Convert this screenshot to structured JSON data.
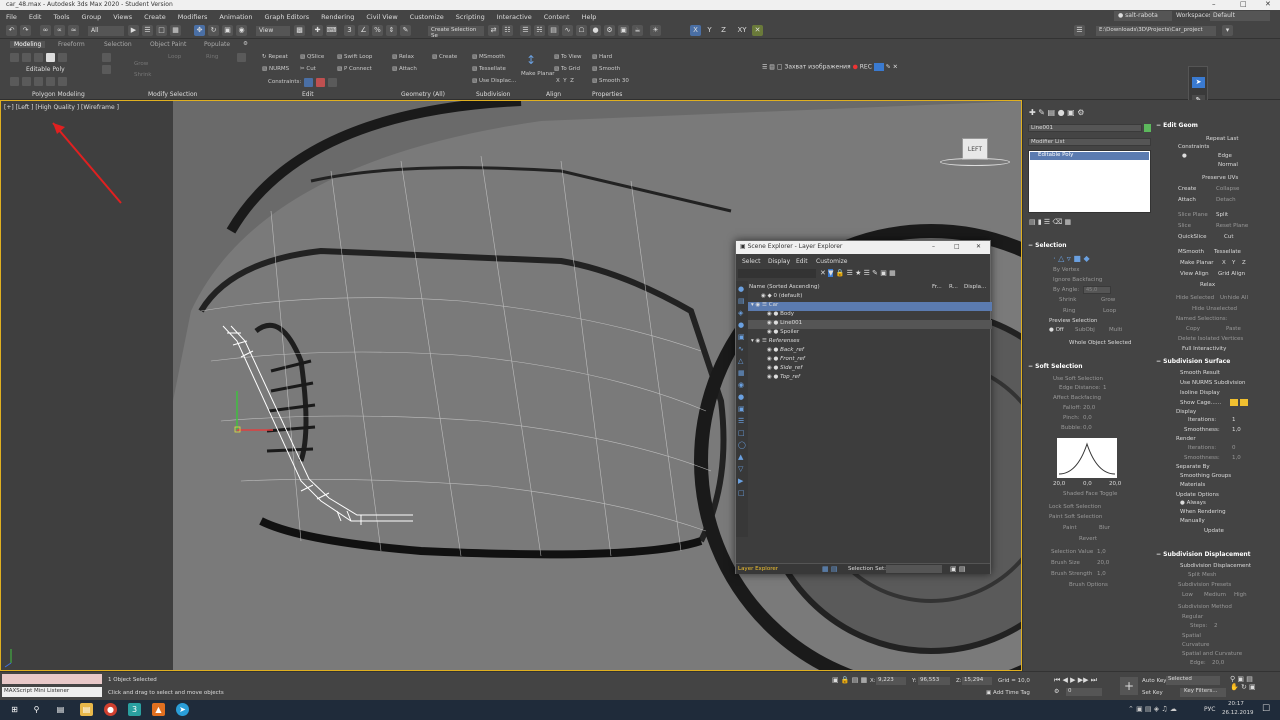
{
  "window": {
    "title": "car_48.max - Autodesk 3ds Max 2020 - Student Version"
  },
  "menu": [
    "File",
    "Edit",
    "Tools",
    "Group",
    "Views",
    "Create",
    "Modifiers",
    "Animation",
    "Graph Editors",
    "Rendering",
    "Civil View",
    "Customize",
    "Scripting",
    "Interactive",
    "Content",
    "Help"
  ],
  "user": {
    "name": "salt-rabota",
    "workspaces_label": "Workspaces:",
    "workspace": "Default"
  },
  "toolbar": {
    "filter": "All",
    "view": "View",
    "selection_set": "Create Selection Se",
    "axes": [
      "X",
      "Y",
      "Z",
      "XY"
    ],
    "project_path": "E:\\Downloads\\3D\\Projects\\Car_project"
  },
  "ribbon": {
    "tabs": [
      "Modeling",
      "Freeform",
      "Selection",
      "Object Paint",
      "Populate"
    ],
    "edit_poly_label": "Editable Poly",
    "groups": [
      "Polygon Modeling",
      "Modify Selection",
      "Edit",
      "Geometry (All)",
      "Subdivision",
      "Align",
      "Properties"
    ],
    "edit_items": [
      "Repeat",
      "QSlice",
      "Swift Loop",
      "NURMS",
      "Cut",
      "P Connect",
      "Constraints:"
    ],
    "geometry_items": [
      "Relax",
      "Create",
      "Attach"
    ],
    "subdivision_items": [
      "MSmooth",
      "Tessellate",
      "Use Displac..."
    ],
    "align_items": [
      "Make Planar",
      "To View",
      "To Grid"
    ],
    "properties_items": [
      "Hard",
      "Smooth",
      "Smooth 30"
    ],
    "modify_items": [
      "Grow",
      "Shrink",
      "Loop",
      "Ring"
    ]
  },
  "capture_bar": {
    "label": "Захват изображения",
    "rec": "REC"
  },
  "viewport": {
    "label": "[+] [Left ] [High Quality ] [Wireframe ]",
    "viewcube": "LEFT"
  },
  "command_panel": {
    "object_name": "Line001",
    "modifier_list": "Modifier List",
    "stack_item": "Editable Poly",
    "selection": {
      "title": "Selection",
      "by_vertex": "By Vertex",
      "ignore_backfacing": "Ignore Backfacing",
      "by_angle": "By Angle:",
      "angle": "45,0",
      "shrink": "Shrink",
      "grow": "Grow",
      "ring": "Ring",
      "loop": "Loop",
      "preview": "Preview Selection",
      "off": "Off",
      "subobj": "SubObj",
      "multi": "Multi",
      "status": "Whole Object Selected"
    },
    "soft": {
      "title": "Soft Selection",
      "use_soft": "Use Soft Selection",
      "edge_distance": "Edge Distance:",
      "edge_distance_value": "1",
      "affect_backfacing": "Affect Backfacing",
      "falloff": "Falloff:",
      "falloff_value": "20,0",
      "pinch": "Pinch:",
      "pinch_value": "0,0",
      "bubble": "Bubble:",
      "bubble_value": "0,0",
      "curve_ticks": [
        "20,0",
        "0,0",
        "20,0"
      ],
      "shaded_face_toggle": "Shaded Face Toggle",
      "lock_soft": "Lock Soft Selection",
      "paint_soft": "Paint Soft Selection",
      "paint": "Paint",
      "blur": "Blur",
      "revert": "Revert",
      "selection_value": "Selection Value",
      "selection_value_num": "1,0",
      "brush_size": "Brush Size",
      "brush_size_num": "20,0",
      "brush_strength": "Brush Strength",
      "brush_strength_num": "1,0",
      "brush_options": "Brush Options"
    }
  },
  "right_panel": {
    "edit_geometry": "Edit Geom",
    "repeat_last": "Repeat Last",
    "constraints": "Constraints",
    "edge": "Edge",
    "normal": "Normal",
    "preserve_uvs": "Preserve UVs",
    "create": "Create",
    "collapse": "Collapse",
    "attach": "Attach",
    "detach": "Detach",
    "slice_plane": "Slice Plane",
    "split": "Split",
    "slice": "Slice",
    "reset_plane": "Reset Plane",
    "quickslice": "QuickSlice",
    "cut": "Cut",
    "msmooth": "MSmooth",
    "tessellate": "Tessellate",
    "make_planar": "Make Planar",
    "x": "X",
    "y": "Y",
    "z": "Z",
    "view_align": "View Align",
    "grid_align": "Grid Align",
    "relax": "Relax",
    "hide_selected": "Hide Selected",
    "unhide_all": "Unhide All",
    "hide_unselected": "Hide Unselected",
    "named_selections": "Named Selections:",
    "copy": "Copy",
    "paste": "Paste",
    "delete_isolated": "Delete Isolated Vertices",
    "full_interactivity": "Full Interactivity",
    "subdiv_surface": {
      "title": "Subdivision Surface",
      "smooth_result": "Smooth Result",
      "use_nurms": "Use NURMS Subdivision",
      "isoline": "Isoline Display",
      "show_cage": "Show Cage......",
      "display": "Display",
      "iterations": "Iterations:",
      "iterations_value": "1",
      "smoothness": "Smoothness:",
      "smoothness_value": "1,0",
      "render": "Render",
      "r_iterations": "Iterations:",
      "r_iterations_value": "0",
      "r_smoothness": "Smoothness:",
      "r_smoothness_value": "1,0",
      "separate_by": "Separate By",
      "smoothing_groups": "Smoothing Groups",
      "materials": "Materials",
      "update_options": "Update Options",
      "always": "Always",
      "when_rendering": "When Rendering",
      "manually": "Manually",
      "update": "Update"
    },
    "subdiv_disp": {
      "title": "Subdivision Displacement",
      "subdiv_disp": "Subdivision Displacement",
      "split_mesh": "Split Mesh",
      "presets": "Subdivision Presets",
      "low": "Low",
      "medium": "Medium",
      "high": "High",
      "method": "Subdivision Method",
      "regular": "Regular",
      "steps": "Steps:",
      "steps_value": "2",
      "spatial": "Spatial",
      "curvature": "Curvature",
      "spatial_curv": "Spatial and Curvature",
      "edge": "Edge:",
      "edge_value": "20,0"
    }
  },
  "scene_explorer": {
    "title": "Scene Explorer - Layer Explorer",
    "menu": [
      "Select",
      "Display",
      "Edit",
      "Customize"
    ],
    "col_name": "Name (Sorted Ascending)",
    "col_fr": "Fr...",
    "col_r": "R...",
    "col_disp": "Displa...",
    "rows": [
      "0 (default)",
      "Car",
      "Body",
      "Line001",
      "Spoiler",
      "Referenses",
      "Back_ref",
      "Front_ref",
      "Side_ref",
      "Top_ref"
    ],
    "footer_label": "Layer Explorer",
    "selection_set": "Selection Set:"
  },
  "status": {
    "objects_selected": "1 Object Selected",
    "hint": "Click and drag to select and move objects",
    "maxscript": "MAXScript Mini Listener",
    "x_label": "X:",
    "x": "9,223",
    "y_label": "Y:",
    "y": "96,553",
    "z_label": "Z:",
    "z": "15,294",
    "grid": "Grid = 10,0",
    "add_time_tag": "Add Time Tag",
    "auto_key": "Auto Key",
    "set_key": "Set Key",
    "selected": "Selected",
    "key_filters": "Key Filters...",
    "frame": "0"
  },
  "taskbar": {
    "time": "20:17",
    "date": "26.12.2019",
    "lang": "РУС"
  }
}
